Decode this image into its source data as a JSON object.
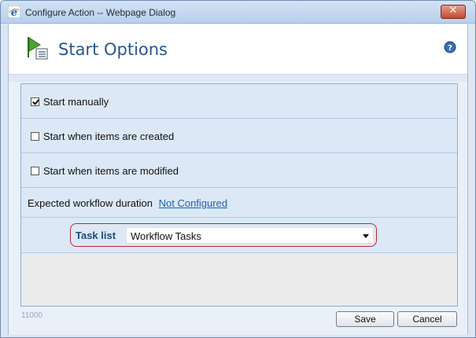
{
  "window": {
    "title": "Configure Action -- Webpage Dialog",
    "app_icon": "internet-explorer-icon",
    "close_icon": "close-x-icon",
    "close_glyph": "✕"
  },
  "header": {
    "icon": "start-flag-list-icon",
    "title": "Start Options",
    "help_icon": "help-question-icon"
  },
  "options": [
    {
      "label": "Start manually",
      "checked": true
    },
    {
      "label": "Start when items are created",
      "checked": false
    },
    {
      "label": "Start when items are modified",
      "checked": false
    }
  ],
  "duration": {
    "label": "Expected workflow duration",
    "link": "Not Configured"
  },
  "task_list": {
    "label": "Task list",
    "value": "Workflow Tasks"
  },
  "footer": {
    "code": "11000",
    "save_label": "Save",
    "cancel_label": "Cancel"
  },
  "colors": {
    "accent": "#27578c",
    "link": "#1862b5",
    "highlight_border": "#c0243a"
  }
}
